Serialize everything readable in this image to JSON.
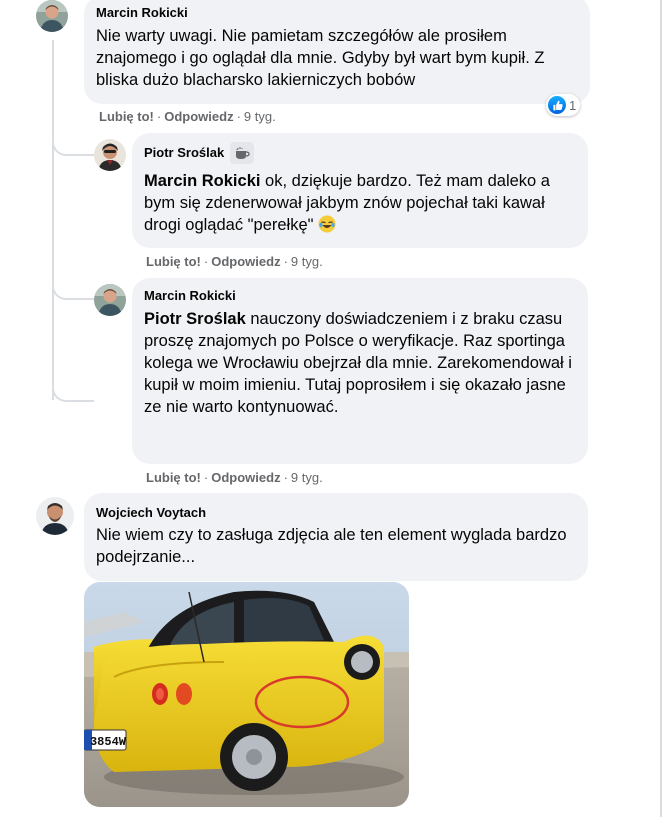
{
  "comments": [
    {
      "author": "Marcin Rokicki",
      "text": "Nie warty uwagi. Nie pamietam szczegółów ale prosiłem znajomego i go oglądał dla mnie. Gdyby był wart bym kupił. Z bliska dużo blacharsko lakierniczych bobów",
      "like": "Lubię to!",
      "reply": "Odpowiedz",
      "time": "9 tyg.",
      "reactions": {
        "count": "1"
      }
    },
    {
      "author": "Piotr Sroślak",
      "badge": "coffee-cup",
      "mention": "Marcin Rokicki",
      "text": " ok, dziękuje bardzo. Też mam daleko a bym się zdenerwował jakbym znów pojechał taki kawał drogi oglądać \"perełkę\"",
      "emoji": "laughing-face",
      "like": "Lubię to!",
      "reply": "Odpowiedz",
      "time": "9 tyg."
    },
    {
      "author": "Marcin Rokicki",
      "mention": "Piotr Sroślak",
      "text": " nauczony doświadczeniem i z braku czasu proszę znajomych po Polsce o weryfikacje. Raz sportinga kolega we Wrocławiu obejrzał dla mnie. Zarekomendował i kupił w moim imieniu. Tutaj poprosiłem i się okazało jasne ze nie warto kontynuować.",
      "like": "Lubię to!",
      "reply": "Odpowiedz",
      "time": "9 tyg."
    },
    {
      "author": "Wojciech Voytach",
      "text": "Nie wiem czy to zasługa zdjęcia ale ten element wyglada bardzo podejrzanie...",
      "photo": {
        "plate": "3854W",
        "subject": "yellow convertible with circled dent"
      }
    }
  ],
  "colors": {
    "bubble": "#f0f2f5",
    "meta": "#65676b",
    "like_blue": "#0571ed",
    "car_yellow": "#f3d21c",
    "circle_red": "#d83a2c"
  }
}
